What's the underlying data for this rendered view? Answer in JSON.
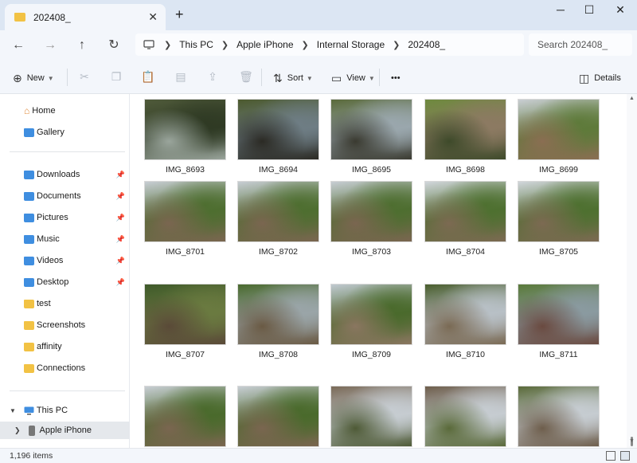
{
  "window": {
    "tab_title": "202408_",
    "tab_close": "✕",
    "new_tab": "+",
    "minimize": "─",
    "maximize": "☐",
    "close": "✕"
  },
  "nav": {
    "back": "←",
    "forward": "→",
    "up": "↑",
    "refresh": "↻",
    "breadcrumb": [
      "This PC",
      "Apple iPhone",
      "Internal Storage",
      "202408_"
    ],
    "search_placeholder": "Search 202408_"
  },
  "toolbar": {
    "new_label": "New",
    "sort_label": "Sort",
    "view_label": "View",
    "more": "•••",
    "details_label": "Details"
  },
  "sidebar": {
    "home": "Home",
    "gallery": "Gallery",
    "quick": [
      "Downloads",
      "Documents",
      "Pictures",
      "Music",
      "Videos",
      "Desktop",
      "test",
      "Screenshots",
      "affinity",
      "Connections"
    ],
    "this_pc": "This PC",
    "device": "Apple iPhone"
  },
  "files": [
    {
      "name": "IMG_8693",
      "palette": [
        "#4f5a3a",
        "#2f3a24",
        "#9aa59c"
      ]
    },
    {
      "name": "IMG_8694",
      "palette": [
        "#4c5a2e",
        "#6e7d84",
        "#2b2a24"
      ]
    },
    {
      "name": "IMG_8695",
      "palette": [
        "#5a6a3a",
        "#9aa7ad",
        "#3a3a30"
      ]
    },
    {
      "name": "IMG_8698",
      "palette": [
        "#6e8a3e",
        "#8c7a62",
        "#3e4a2a"
      ]
    },
    {
      "name": "IMG_8699",
      "palette": [
        "#c9ced3",
        "#5e7a3a",
        "#8a6e52"
      ]
    },
    {
      "name": "IMG_8701",
      "palette": [
        "#c7cdd3",
        "#4e6e30",
        "#7a6650"
      ]
    },
    {
      "name": "IMG_8702",
      "palette": [
        "#c7cdd3",
        "#4e6e30",
        "#7a6650"
      ]
    },
    {
      "name": "IMG_8703",
      "palette": [
        "#c7cdd3",
        "#4e6e30",
        "#7a6650"
      ]
    },
    {
      "name": "IMG_8704",
      "palette": [
        "#d1d6db",
        "#4e7030",
        "#7c6a52"
      ]
    },
    {
      "name": "IMG_8705",
      "palette": [
        "#d1d6db",
        "#4e7030",
        "#7c6a52"
      ]
    },
    {
      "name": "IMG_8707",
      "palette": [
        "#3f5a2a",
        "#6a7a40",
        "#5a4a38"
      ]
    },
    {
      "name": "IMG_8708",
      "palette": [
        "#4a6a2e",
        "#9aa5a8",
        "#6a5a44"
      ]
    },
    {
      "name": "IMG_8709",
      "palette": [
        "#c0c9d0",
        "#4a6a2c",
        "#8a7660"
      ]
    },
    {
      "name": "IMG_8710",
      "palette": [
        "#4a5e2e",
        "#b8c0c6",
        "#7a6a54"
      ]
    },
    {
      "name": "IMG_8711",
      "palette": [
        "#5a7a3a",
        "#8a9aa0",
        "#6a4a40"
      ]
    },
    {
      "name": "",
      "palette": [
        "#c8ced4",
        "#4a6a2c",
        "#7a6650"
      ]
    },
    {
      "name": "",
      "palette": [
        "#c8ced4",
        "#4a6a2c",
        "#7a6650"
      ]
    },
    {
      "name": "",
      "palette": [
        "#7a6a58",
        "#c6ccd1",
        "#4e5a36"
      ]
    },
    {
      "name": "",
      "palette": [
        "#6e5e4c",
        "#c6ccd1",
        "#5a6a3a"
      ]
    },
    {
      "name": "",
      "palette": [
        "#5a6a3a",
        "#c6ccd1",
        "#6e5e4c"
      ]
    }
  ],
  "status": {
    "count": "1,196 items"
  }
}
